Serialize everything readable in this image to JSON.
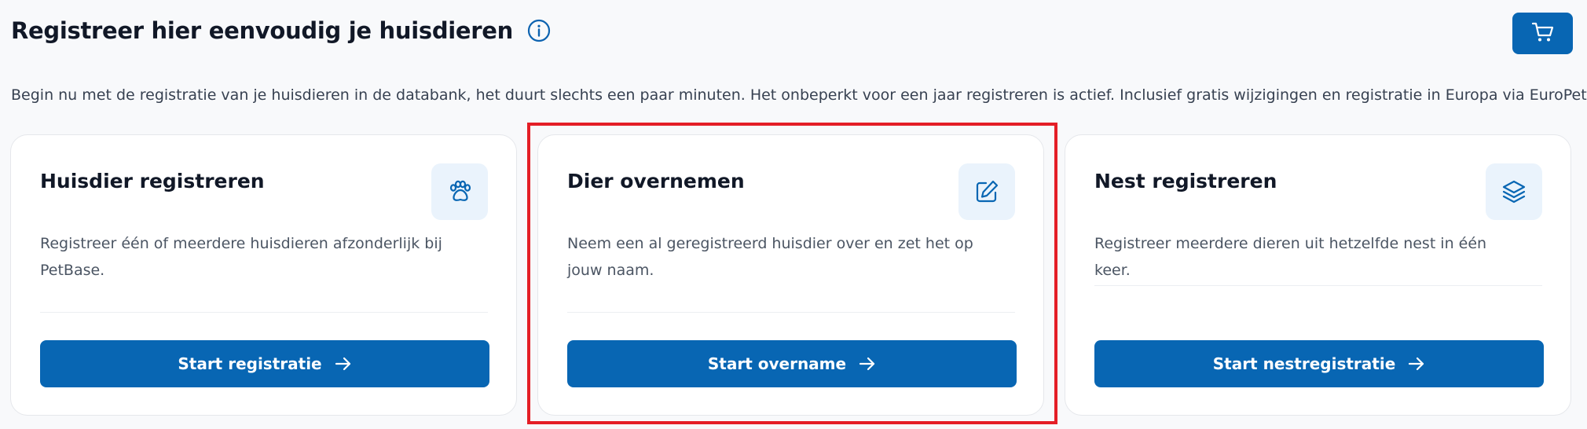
{
  "header": {
    "title": "Registreer hier eenvoudig je huisdieren",
    "info_icon": "info-icon",
    "cart_icon": "cart-icon"
  },
  "intro": "Begin nu met de registratie van je huisdieren in de databank, het duurt slechts een paar minuten. Het onbeperkt voor een jaar registreren is actief. Inclusief gratis wijzigingen en registratie in Europa via EuroPetNet.",
  "cards": [
    {
      "title": "Huisdier registreren",
      "icon": "paw-icon",
      "description": "Registreer één of meerdere huisdieren afzonderlijk bij PetBase.",
      "button_label": "Start registratie"
    },
    {
      "title": "Dier overnemen",
      "icon": "edit-icon",
      "description": "Neem een al geregistreerd huisdier over en zet het op jouw naam.",
      "button_label": "Start overname"
    },
    {
      "title": "Nest registreren",
      "icon": "layers-icon",
      "description": "Registreer meerdere dieren uit hetzelfde nest in één keer.",
      "button_label": "Start nestregistratie"
    }
  ],
  "colors": {
    "primary": "#0866b3",
    "icon_bg": "#eaf3fc",
    "highlight": "#e41e26",
    "background": "#f8f9fb"
  }
}
